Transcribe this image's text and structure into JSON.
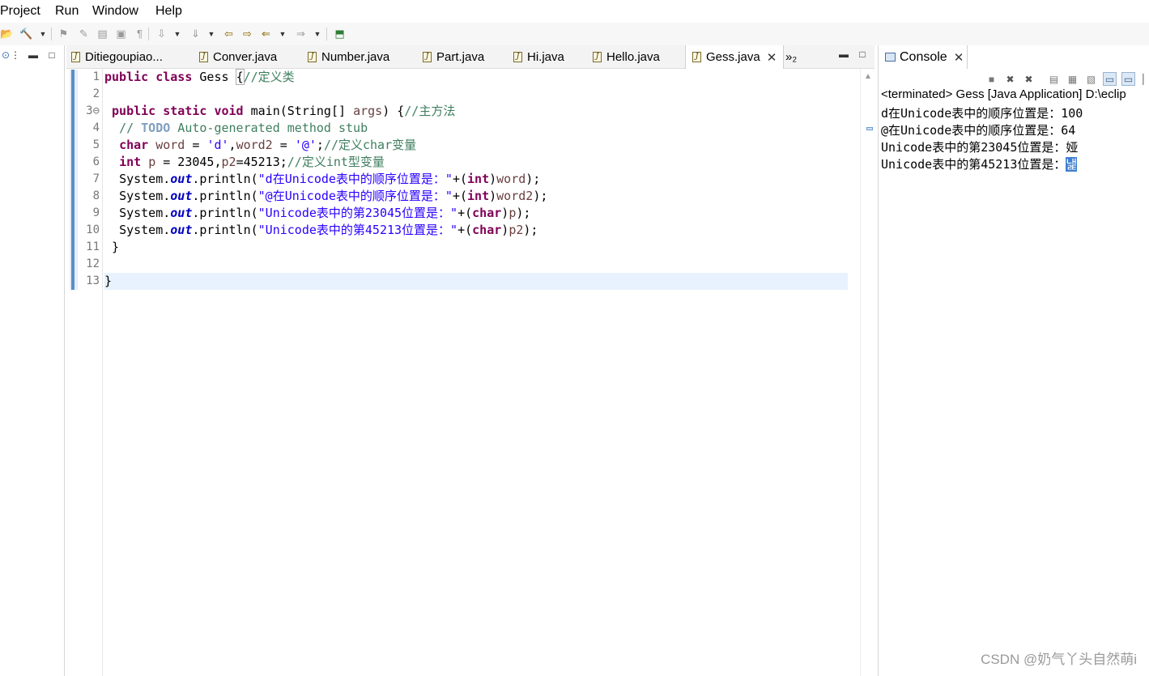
{
  "menu": [
    "Project",
    "Run",
    "Window",
    "Help"
  ],
  "toolbar_icons": [
    "open-icon",
    "build-icon",
    "dropdown-icon",
    "toggle-icon",
    "mark-icon",
    "format-icon",
    "block-icon",
    "pilcrow-icon",
    "nav-icon",
    "dropdown-icon",
    "next-annotation-icon",
    "dropdown-icon",
    "prev-edit-icon",
    "next-edit-icon",
    "back-icon",
    "dropdown-icon",
    "forward-icon",
    "dropdown-icon",
    "pin-editor-icon"
  ],
  "editor_tabs": [
    {
      "label": "Ditiegoupiao..."
    },
    {
      "label": "Conver.java"
    },
    {
      "label": "Number.java"
    },
    {
      "label": "Part.java"
    },
    {
      "label": "Hi.java"
    },
    {
      "label": "Hello.java"
    },
    {
      "label": "Gess.java",
      "active": true
    }
  ],
  "overflow_label": "»₂",
  "line_numbers": [
    "1",
    "2",
    "3⊖",
    "4",
    "5",
    "6",
    "7",
    "8",
    "9",
    "10",
    "11",
    "12",
    "13"
  ],
  "code": {
    "l1": {
      "kw1": "public",
      "kw2": "class",
      "name": " Gess ",
      "brace": "{",
      "comment": "//定义类"
    },
    "l3": {
      "kw1": "public",
      "kw2": "static",
      "kw3": "void",
      "rest": " main(String[] ",
      "arg": "args",
      "brace": ") {",
      "comment": "//主方法"
    },
    "l4": {
      "prefix": "// ",
      "todo": "TODO",
      "rest": " Auto-generated method stub"
    },
    "l5": {
      "kw": "char",
      "v1": "word",
      "eq": " = ",
      "s1": "'d'",
      "mid": ",",
      "v2": "word2",
      "eq2": " = ",
      "s2": "'@'",
      "end": ";",
      "comment": "//定义char变量"
    },
    "l6": {
      "kw": "int",
      "v1": "p",
      "mid": " = 23045,",
      "v2": "p2",
      "end": "=45213;",
      "comment": "//定义int型变量"
    },
    "l7": {
      "sys": "System.",
      "out": "out",
      "call": ".println(",
      "str": "\"d在Unicode表中的顺序位置是：\"",
      "plus": "+(",
      "kw": "int",
      "close": ")",
      "var": "word",
      "end": ");"
    },
    "l8": {
      "sys": "System.",
      "out": "out",
      "call": ".println(",
      "str": "\"@在Unicode表中的顺序位置是：\"",
      "plus": "+(",
      "kw": "int",
      "close": ")",
      "var": "word2",
      "end": ");"
    },
    "l9": {
      "sys": "System.",
      "out": "out",
      "call": ".println(",
      "str": "\"Unicode表中的第23045位置是：\"",
      "plus": "+(",
      "kw": "char",
      "close": ")",
      "var": "p",
      "end": ");"
    },
    "l10": {
      "sys": "System.",
      "out": "out",
      "call": ".println(",
      "str": "\"Unicode表中的第45213位置是：\"",
      "plus": "+(",
      "kw": "char",
      "close": ")",
      "var": "p2",
      "end": ");"
    },
    "l11": " }",
    "l13": "}"
  },
  "console": {
    "tab_label": "Console",
    "status": "<terminated> Gess [Java Application] D:\\eclip",
    "output": [
      "d在Unicode表中的顺序位置是：100",
      "@在Unicode表中的顺序位置是：64",
      "Unicode表中的第23045位置是：娅"
    ],
    "last_line_text": "Unicode表中的第45213位置是：",
    "last_line_selected": "냁"
  },
  "watermark": "CSDN @奶气丫头自然萌i"
}
